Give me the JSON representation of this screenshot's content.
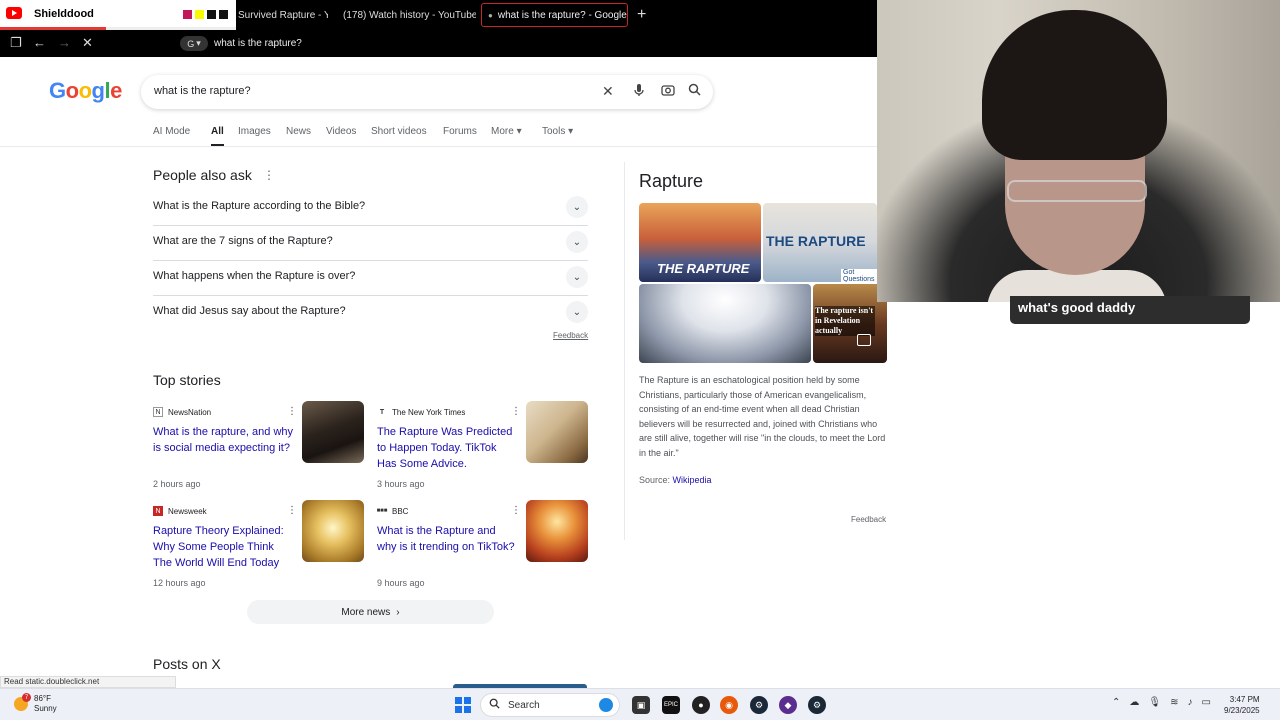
{
  "youtube_bar": {
    "channel_name": "Shielddood",
    "swatch_colors": [
      "#c2185b",
      "#f9f900",
      "#111111",
      "#111111"
    ],
    "progress_fraction": 0.45
  },
  "browser": {
    "tabs": [
      {
        "title": "Survived Rapture - Yo",
        "close": "✕"
      },
      {
        "title": "(178) Watch history - YouTube",
        "close": "✕"
      },
      {
        "title": "what is the rapture? - Google Se",
        "close": "✕"
      }
    ],
    "new_tab": "+",
    "address": "what is the rapture?"
  },
  "google": {
    "logo": [
      "G",
      "o",
      "o",
      "g",
      "l",
      "e"
    ],
    "logo_colors": [
      "#4285f4",
      "#ea4335",
      "#fbbc05",
      "#4285f4",
      "#34a853",
      "#ea4335"
    ],
    "query": "what is the rapture?",
    "tabs": [
      "AI Mode",
      "All",
      "Images",
      "News",
      "Videos",
      "Short videos",
      "Forums",
      "More",
      "Tools"
    ],
    "people_also_ask": {
      "title": "People also ask",
      "questions": [
        "What is the Rapture according to the Bible?",
        "What are the 7 signs of the Rapture?",
        "What happens when the Rapture is over?",
        "What did Jesus say about the Rapture?"
      ],
      "feedback": "Feedback"
    },
    "top_stories": {
      "title": "Top stories",
      "stories": [
        {
          "source": "NewsNation",
          "headline": "What is the rapture, and why is social media expecting it?",
          "time": "2 hours ago"
        },
        {
          "source": "The New York Times",
          "headline": "The Rapture Was Predicted to Happen Today. TikTok Has Some Advice.",
          "time": "3 hours ago"
        },
        {
          "source": "Newsweek",
          "headline": "Rapture Theory Explained: Why Some People Think The World Will End Today",
          "time": "12 hours ago"
        },
        {
          "source": "BBC",
          "headline": "What is the Rapture and why is it trending on TikTok?",
          "time": "9 hours ago"
        }
      ],
      "more_news": "More news"
    },
    "posts_on_x": "Posts on X",
    "knowledge_panel": {
      "title": "Rapture",
      "image_captions": [
        "THE RAPTURE",
        "THE RAPTURE",
        "Got Questions",
        "The rapture isn't in Revelation actually"
      ],
      "description": "The Rapture is an eschatological position held by some Christians, particularly those of American evangelicalism, consisting of an end-time event when all dead Christian believers will be resurrected and, joined with Christians who are still alive, together will rise \"in the clouds, to meet the Lord in the air.\"",
      "source_label": "Source:",
      "source_link": "Wikipedia",
      "feedback": "Feedback"
    }
  },
  "webcam": {
    "caption": "what's good daddy"
  },
  "status_text": "Read static.doubleclick.net",
  "taskbar": {
    "weather_temp": "86°F",
    "weather_desc": "Sunny",
    "weather_badge": "7",
    "search_label": "Search",
    "time": "3:47 PM",
    "date": "9/23/2025"
  }
}
